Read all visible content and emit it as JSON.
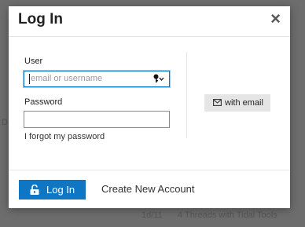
{
  "backdrop": {
    "snippet_left": "D",
    "snippet_bottom_time": "1d/11",
    "snippet_bottom_text": "4 Threads with Tidal Tools"
  },
  "modal": {
    "title": "Log In",
    "close_symbol": "×",
    "user_label": "User",
    "user_placeholder": "email or username",
    "password_label": "Password",
    "forgot_password": "I forgot my password",
    "email_button_label": "with email",
    "login_button_label": "Log In",
    "create_account_label": "Create New Account"
  },
  "icons": {
    "close": "close-icon",
    "key": "key-icon",
    "envelope": "envelope-icon",
    "lock": "unlock-icon"
  },
  "colors": {
    "accent": "#0f76c4",
    "focus_ring": "#0a76c8"
  }
}
